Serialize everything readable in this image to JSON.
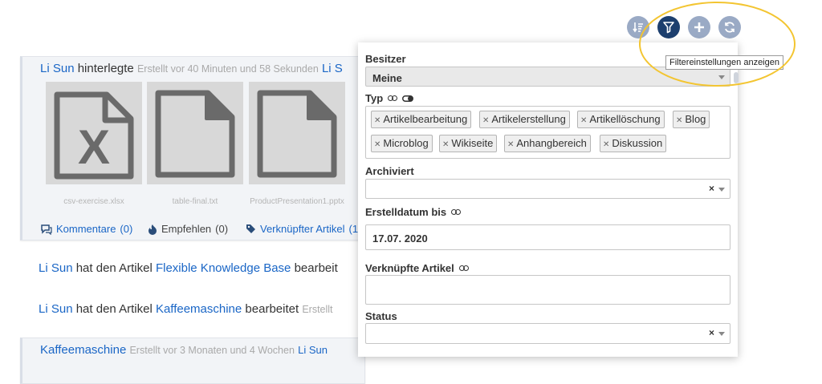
{
  "toolbar": {
    "buttons": [
      {
        "name": "sort-button",
        "icon": "sort-icon"
      },
      {
        "name": "filter-button",
        "icon": "filter-icon",
        "active": true
      },
      {
        "name": "add-button",
        "icon": "plus-icon"
      },
      {
        "name": "refresh-button",
        "icon": "refresh-icon"
      }
    ],
    "tooltip": "Filtereinstellungen anzeigen"
  },
  "feed": {
    "item1": {
      "user": "Li Sun",
      "verb": "hinterlegte",
      "meta": "Erstellt vor 40 Minuten und 58 Sekunden",
      "trailing_user": "Li S",
      "attachments": [
        {
          "caption": "csv-exercise.xlsx",
          "icon": "excel-file-icon"
        },
        {
          "caption": "table-final.txt",
          "icon": "document-file-icon"
        },
        {
          "caption": "ProductPresentation1.pptx",
          "icon": "document-file-icon"
        }
      ],
      "comments_label": "Kommentare",
      "comments_count": "(0)",
      "recommend_label": "Empfehlen",
      "recommend_count": "(0)",
      "linked_label": "Verknüpfter Artikel",
      "linked_count": "(1"
    },
    "item2": {
      "user": "Li Sun",
      "text1": "hat den Artikel",
      "article": "Flexible Knowledge Base",
      "text2": "bearbeit"
    },
    "item3": {
      "user": "Li Sun",
      "text1": "hat den Artikel",
      "article": "Kaffeemaschine",
      "text2": "bearbeitet",
      "meta": "Erstellt"
    },
    "item4": {
      "title": "Kaffeemaschine",
      "meta": "Erstellt vor 3 Monaten und 4 Wochen",
      "user": "Li Sun"
    }
  },
  "filter": {
    "owner_label": "Besitzer",
    "owner_value": "Meine",
    "type_label": "Typ",
    "type_tags": [
      "Artikelbearbeitung",
      "Artikelerstellung",
      "Artikellöschung",
      "Blog",
      "Microblog",
      "Wikiseite",
      "Anhangbereich",
      "Diskussion"
    ],
    "archived_label": "Archiviert",
    "archived_value": "",
    "created_label": "Erstelldatum bis",
    "created_value": "17.07. 2020",
    "linked_label": "Verknüpfte Artikel",
    "linked_value": "",
    "status_label": "Status",
    "status_value": "",
    "clear_glyph": "×"
  }
}
